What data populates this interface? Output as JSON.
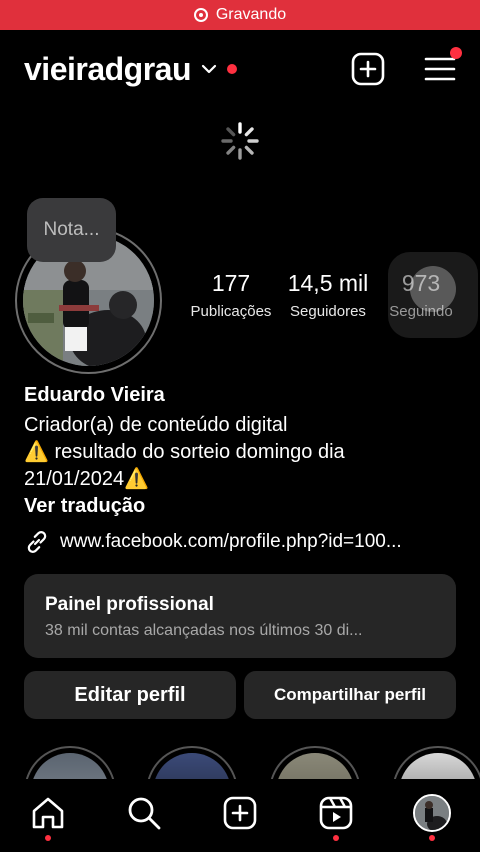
{
  "recording": {
    "label": "Gravando",
    "color": "#e0303c"
  },
  "header": {
    "username": "vieiradgrau",
    "icons": [
      "chevron-down-icon",
      "new-post-icon",
      "menu-icon"
    ]
  },
  "note": {
    "placeholder": "Nota..."
  },
  "stats": [
    {
      "value": "177",
      "label": "Publicações"
    },
    {
      "value": "14,5 mil",
      "label": "Seguidores"
    },
    {
      "value": "973",
      "label": "Seguindo"
    }
  ],
  "bio": {
    "name": "Eduardo Vieira",
    "category": "Criador(a) de conteúdo digital",
    "line1": "⚠️ resultado do sorteio domingo dia",
    "line2": "21/01/2024⚠️",
    "translate": "Ver tradução",
    "link": "www.facebook.com/profile.php?id=100..."
  },
  "dashboard": {
    "title": "Painel profissional",
    "subtitle": "38 mil contas alcançadas nos últimos 30 di..."
  },
  "buttons": {
    "edit": "Editar perfil",
    "share": "Compartilhar perfil"
  },
  "nav": [
    "home-icon",
    "search-icon",
    "create-icon",
    "reels-icon",
    "profile-avatar"
  ],
  "colors": {
    "accent_red": "#ff3040",
    "surface": "#262626",
    "background": "#000000"
  }
}
